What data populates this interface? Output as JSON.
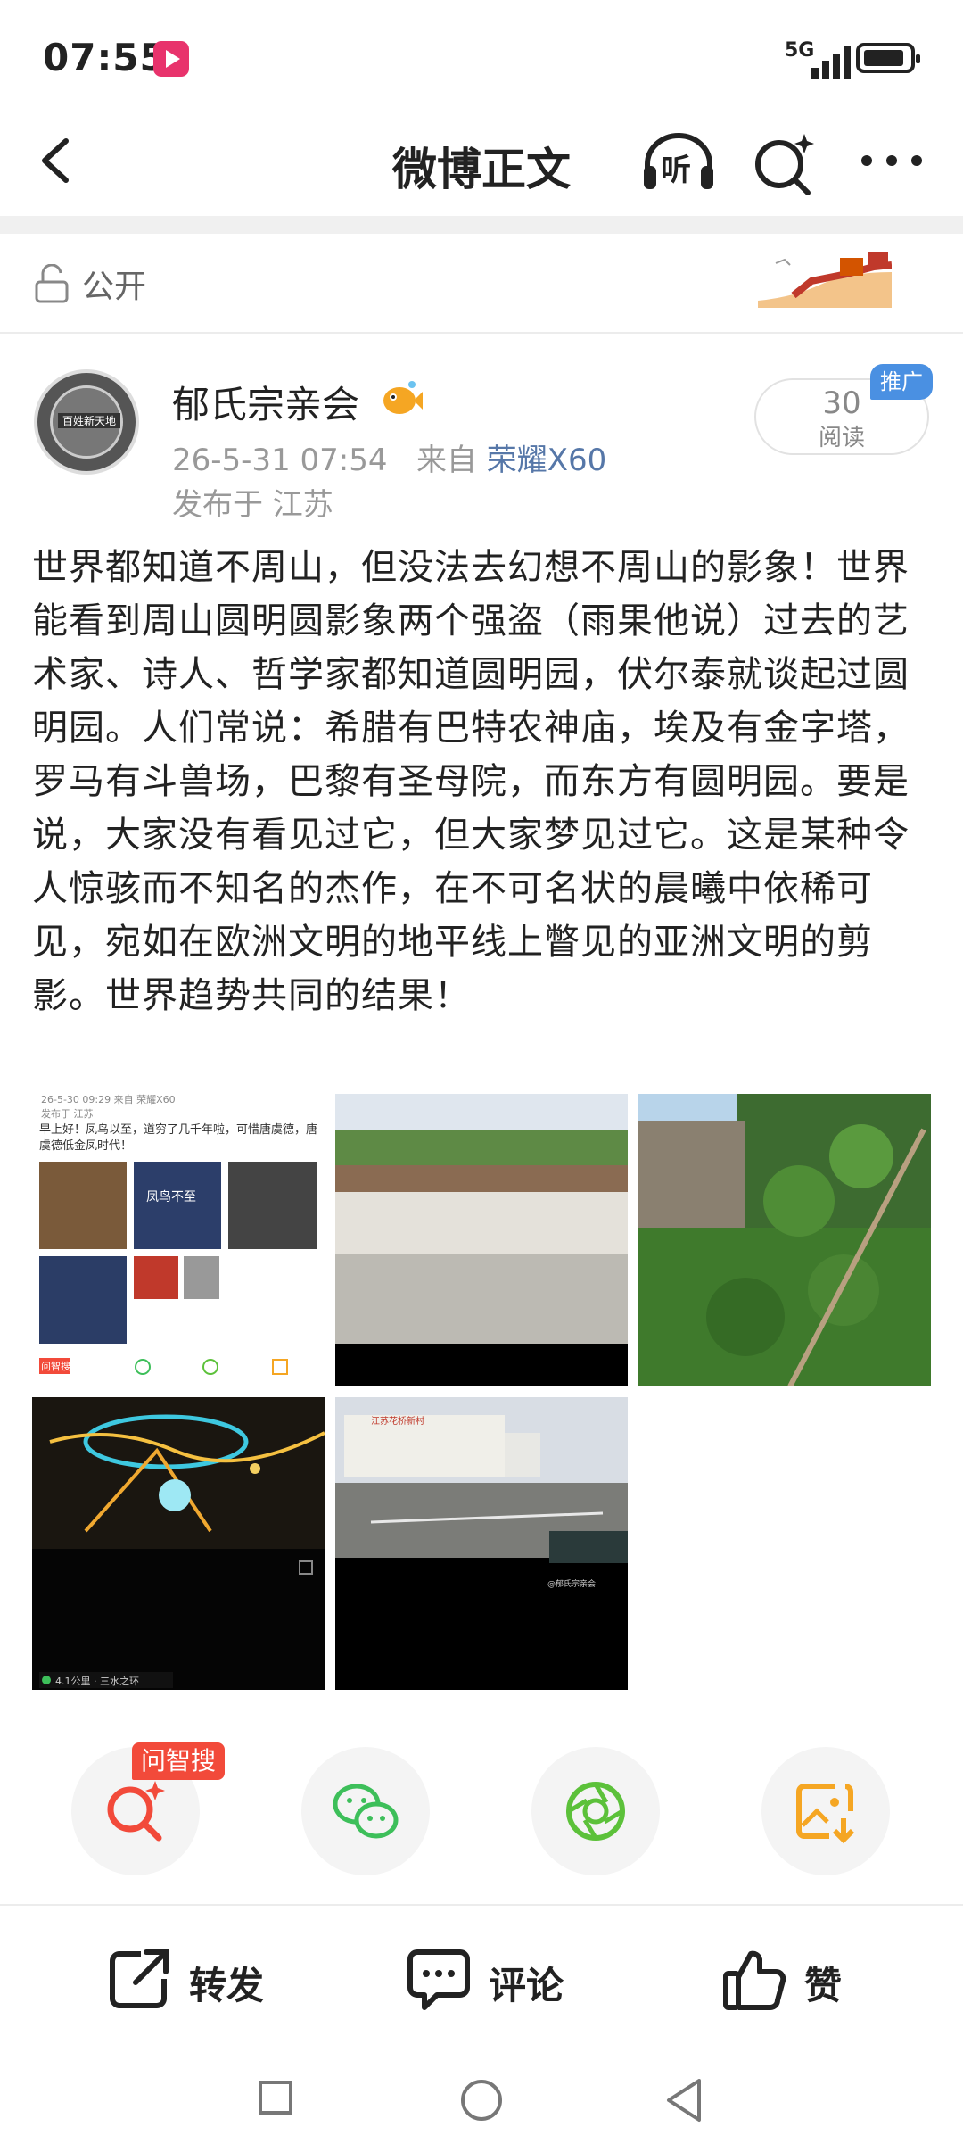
{
  "status_bar": {
    "time": "07:55",
    "network": "5G"
  },
  "nav": {
    "title": "微博正文",
    "listen_label": "听"
  },
  "visibility": {
    "label": "公开"
  },
  "author": {
    "name": "郁氏宗亲会",
    "avatar_text": "百姓新天地",
    "timestamp": "26-5-31 07:54",
    "source_prefix": "来自",
    "device": "荣耀X60",
    "location": "发布于 江苏"
  },
  "stats": {
    "read_count": "30",
    "read_label": "阅读",
    "promo_badge": "推广"
  },
  "post": {
    "text": "世界都知道不周山，但没法去幻想不周山的影象！世界能看到周山圆明圆影象两个强盗（雨果他说）过去的艺术家、诗人、哲学家都知道圆明园，伏尔泰就谈起过圆明园。人们常说：希腊有巴特农神庙，埃及有金字塔，罗马有斗兽场，巴黎有圣母院，而东方有圆明园。要是说，大家没有看见过它，但大家梦见过它。这是某种令人惊骇而不知名的杰作，在不可名状的晨曦中依稀可见，宛如在欧洲文明的地平线上瞥见的亚洲文明的剪影。世界趋势共同的结果！"
  },
  "images": {
    "img1": {
      "meta": "26-5-30 09:29  来自 荣耀X60",
      "meta2": "发布于 江苏",
      "text": "早上好！凤鸟以至，道穷了几千年啦，可惜唐虞德，唐虞德低金凤时代！",
      "caption": "凤鸟不至",
      "tag": "问智搜"
    },
    "img4": {
      "location": "4.1公里 · 三水之环"
    },
    "img5": {
      "sign": "江苏花桥新村",
      "watermark": "@郁氏宗亲会"
    }
  },
  "actions": {
    "zhisou_badge": "问智搜"
  },
  "bottom_bar": {
    "repost": "转发",
    "comment": "评论",
    "like": "赞"
  },
  "colors": {
    "accent_red": "#f24a3a",
    "wechat_green": "#3dbf5a",
    "moments_green": "#5cc13a",
    "save_orange": "#f5a623",
    "promo_blue": "#4a90e2",
    "device_link": "#5677a8"
  }
}
